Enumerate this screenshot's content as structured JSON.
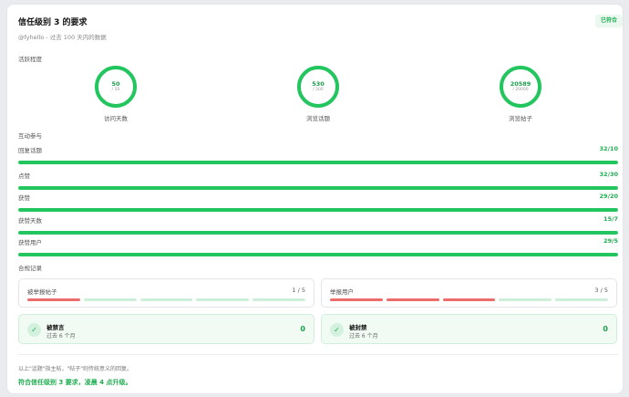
{
  "header": {
    "title": "信任级别 3 的要求",
    "subtitle": "@fyhello - 过去 100 天内的数据",
    "status_badge": "已符合"
  },
  "activity": {
    "label": "活跃程度",
    "rings": [
      {
        "value": "50",
        "target": "/ 50",
        "label": "访问天数",
        "progress": 1.0
      },
      {
        "value": "530",
        "target": "/ 500",
        "label": "浏览话题",
        "progress": 1.0
      },
      {
        "value": "20589",
        "target": "/ 20000",
        "label": "浏览帖子",
        "progress": 1.0
      }
    ]
  },
  "interaction": {
    "label": "互动参与",
    "bars": [
      {
        "label": "回复话题",
        "value": "32/10",
        "progress": 1.0
      },
      {
        "label": "点赞",
        "value": "32/30",
        "progress": 1.0
      },
      {
        "label": "获赞",
        "value": "29/20",
        "progress": 1.0
      },
      {
        "label": "获赞天数",
        "value": "15/7",
        "progress": 1.0
      },
      {
        "label": "获赞用户",
        "value": "29/5",
        "progress": 1.0
      }
    ]
  },
  "compliance": {
    "label": "合规记录",
    "reports": [
      {
        "label": "被举报帖子",
        "value": "1 / 5",
        "red_segments": 1,
        "total_segments": 5
      },
      {
        "label": "举报用户",
        "value": "3 / 5",
        "red_segments": 3,
        "total_segments": 5
      }
    ],
    "bans": [
      {
        "title": "被禁言",
        "subtitle": "过去 6 个月",
        "count": "0"
      },
      {
        "title": "被封禁",
        "subtitle": "过去 6 个月",
        "count": "0"
      }
    ]
  },
  "footer": {
    "note": "以上\"话题\"指主帖，\"帖子\"则传统意义的回复。",
    "conclusion": "符合信任级别 3 要求，凌晨 4 点升级。"
  },
  "colors": {
    "accent": "#22c55e",
    "danger": "#ec6b6b",
    "track": "#d7f3e0"
  }
}
